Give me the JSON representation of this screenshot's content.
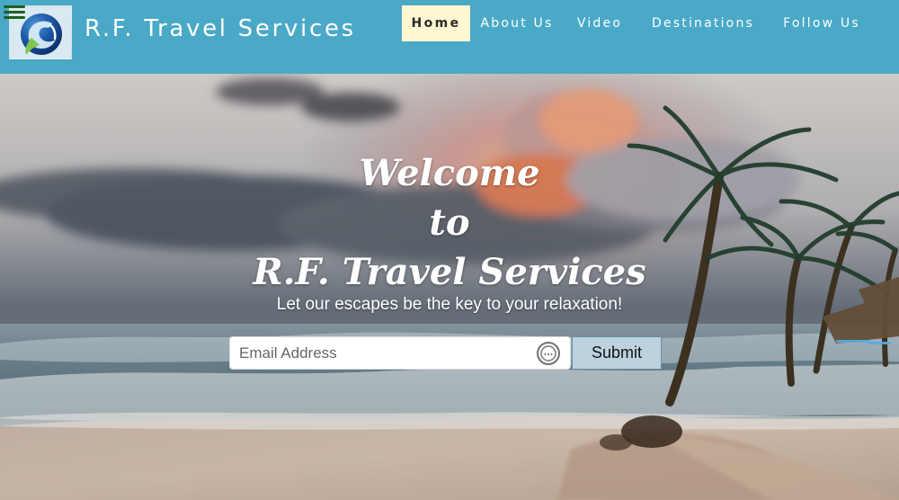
{
  "header": {
    "brand": "R.F. Travel Services",
    "icons": {
      "menu": "hamburger-menu-icon",
      "logo": "globe-logo-icon"
    },
    "nav": [
      {
        "label": "Home",
        "active": true
      },
      {
        "label": "About Us",
        "active": false
      },
      {
        "label": "Video",
        "active": false
      },
      {
        "label": "Destinations",
        "active": false
      },
      {
        "label": "Follow Us",
        "active": false
      }
    ]
  },
  "hero": {
    "title_lines": [
      "Welcome",
      "to",
      "R.F. Travel Services"
    ],
    "subtitle": "Let our escapes be the key to your relaxation!",
    "form": {
      "email_placeholder": "Email Address",
      "submit_label": "Submit"
    },
    "background": "beach-sunset-palm-trees"
  },
  "colors": {
    "header_background": "#49a9c7",
    "active_nav_background": "#fef7d2",
    "submit_background": "#bcd2df",
    "menu_icon": "#1f5e21"
  }
}
